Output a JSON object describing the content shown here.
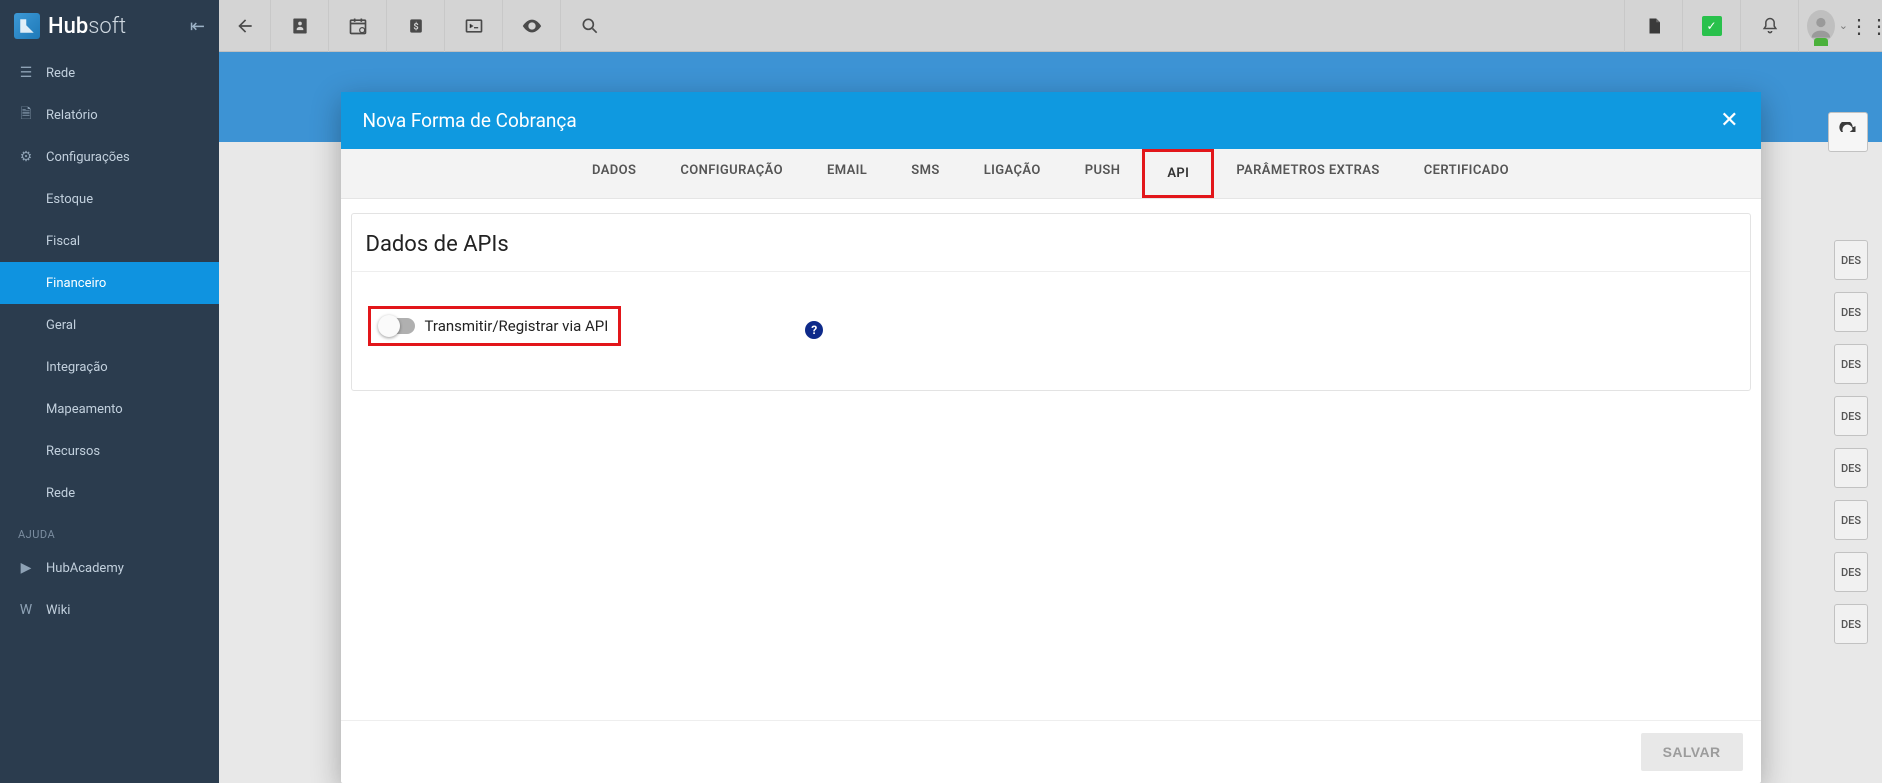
{
  "app_name_hub": "Hub",
  "app_name_soft": "soft",
  "sidebar": {
    "items": [
      {
        "label": "Rede",
        "icon": "network"
      },
      {
        "label": "Relatório",
        "icon": "report"
      },
      {
        "label": "Configurações",
        "icon": "gear"
      },
      {
        "label": "Estoque",
        "icon": ""
      },
      {
        "label": "Fiscal",
        "icon": ""
      },
      {
        "label": "Financeiro",
        "icon": "",
        "active": true
      },
      {
        "label": "Geral",
        "icon": ""
      },
      {
        "label": "Integração",
        "icon": ""
      },
      {
        "label": "Mapeamento",
        "icon": ""
      },
      {
        "label": "Recursos",
        "icon": ""
      },
      {
        "label": "Rede",
        "icon": ""
      }
    ],
    "help_section": "AJUDA",
    "help_items": [
      {
        "label": "HubAcademy",
        "icon": "youtube"
      },
      {
        "label": "Wiki",
        "icon": "wiki"
      }
    ]
  },
  "modal": {
    "title": "Nova Forma de Cobrança",
    "tabs": [
      "DADOS",
      "CONFIGURAÇÃO",
      "EMAIL",
      "SMS",
      "LIGAÇÃO",
      "PUSH",
      "API",
      "PARÂMETROS EXTRAS",
      "CERTIFICADO"
    ],
    "active_tab": "API",
    "panel_title": "Dados de APIs",
    "toggle_label": "Transmitir/Registrar via API",
    "toggle_on": false,
    "save_label": "SALVAR"
  },
  "bg_button_text": "DES"
}
